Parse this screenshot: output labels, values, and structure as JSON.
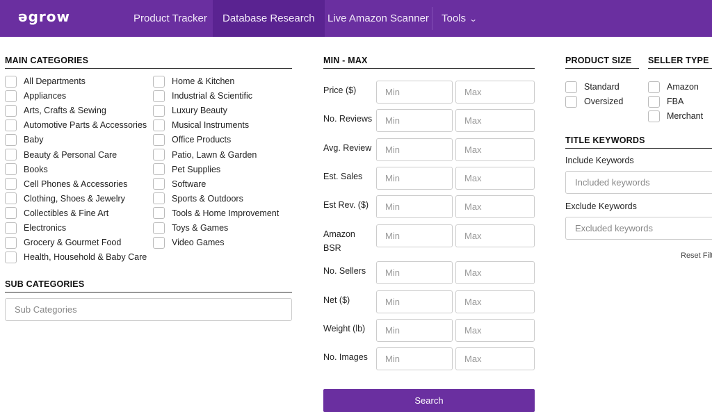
{
  "nav": {
    "logo": "ǝgrow",
    "items": [
      "Product Tracker",
      "Database Research",
      "Live Amazon Scanner"
    ],
    "tools_label": "Tools"
  },
  "main_categories": {
    "title": "MAIN CATEGORIES",
    "col1": [
      "All Departments",
      "Appliances",
      "Arts, Crafts & Sewing",
      "Automotive Parts & Accessories",
      "Baby",
      "Beauty & Personal Care",
      "Books",
      "Cell Phones & Accessories",
      "Clothing, Shoes & Jewelry",
      "Collectibles & Fine Art",
      "Electronics",
      "Grocery & Gourmet Food",
      "Health, Household & Baby Care"
    ],
    "col2": [
      "Home & Kitchen",
      "Industrial & Scientific",
      "Luxury Beauty",
      "Musical Instruments",
      "Office Products",
      "Patio, Lawn & Garden",
      "Pet Supplies",
      "Software",
      "Sports & Outdoors",
      "Tools & Home Improvement",
      "Toys & Games",
      "Video Games"
    ]
  },
  "sub_categories": {
    "title": "SUB CATEGORIES",
    "placeholder": "Sub Categories"
  },
  "min_max": {
    "title": "MIN - MAX",
    "min_placeholder": "Min",
    "max_placeholder": "Max",
    "rows": [
      "Price ($)",
      "No. Reviews",
      "Avg. Review",
      "Est. Sales",
      "Est Rev. ($)",
      "Amazon BSR",
      "No. Sellers",
      "Net ($)",
      "Weight (lb)",
      "No. Images"
    ]
  },
  "search_button": "Search",
  "product_size": {
    "title": "PRODUCT SIZE",
    "options": [
      "Standard",
      "Oversized"
    ]
  },
  "seller_type": {
    "title": "SELLER TYPE",
    "options": [
      "Amazon",
      "FBA",
      "Merchant"
    ]
  },
  "title_keywords": {
    "title": "TITLE KEYWORDS",
    "include_label": "Include Keywords",
    "include_placeholder": "Included keywords",
    "exclude_label": "Exclude Keywords",
    "exclude_placeholder": "Excluded keywords"
  },
  "reset_label": "Reset Filt",
  "colors": {
    "brand": "#6a2fa0",
    "brand_dark": "#5a2391"
  }
}
